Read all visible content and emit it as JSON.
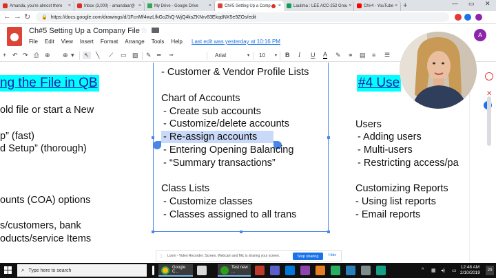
{
  "tabs": [
    {
      "label": "Amanda, you're almost there",
      "color": "#d93025",
      "active": false
    },
    {
      "label": "Inbox (3,000) - amandaar@",
      "color": "#d93025",
      "active": false
    },
    {
      "label": "My Drive - Google Drive",
      "color": "#34a853",
      "active": false
    },
    {
      "label": "Ch#5 Setting Up a Comp",
      "color": "#db4437",
      "active": true
    },
    {
      "label": "Laulima : LEE ACC-252 Grou",
      "color": "#0f9d58",
      "active": false
    },
    {
      "label": "Ch#4 - YouTube",
      "color": "#ff0000",
      "active": false
    }
  ],
  "tab_close": "×",
  "address": {
    "url": "https://docs.google.com/drawings/d/1FcnMf4wzLfkGoZhQ-WjQ4ksZKNrv83EkqdNX5e9ZOs/edit",
    "lock": "🔒"
  },
  "nav": {
    "back": "←",
    "forward": "→",
    "reload": "↻"
  },
  "doc": {
    "title": "Ch#5 Setting Up a Company File",
    "star": "☆",
    "menu": [
      "File",
      "Edit",
      "View",
      "Insert",
      "Format",
      "Arrange",
      "Tools",
      "Help"
    ],
    "last_edit": "Last edit was yesterday at 10:16 PM",
    "avatar": "A"
  },
  "toolbar": {
    "icons": [
      "+",
      "↶",
      "↷",
      "⎙",
      "⊕",
      "▾",
      "↖",
      "╲",
      "⟋",
      "▭",
      "▧",
      "▾",
      "✎",
      "━",
      "┅"
    ],
    "font": "Arial",
    "size": "10",
    "bold": "B",
    "italic": "I",
    "underline": "U",
    "color": "A"
  },
  "slide": {
    "left_heading": "ng the File in QB",
    "left_lines": [
      "old file or start a New",
      "p” (fast)",
      "d Setup” (thorough)",
      "ounts (COA) options",
      "s/customers, bank",
      "oducts/service Items"
    ],
    "center_top": "- Customer & Vendor Profile Lists",
    "center_heading_1": "Chart of Accounts",
    "center_list_1": [
      "- Create sub accounts",
      "- Customize/delete accounts",
      "- Re-assign accounts",
      "- Entering Opening Balancing",
      "- “Summary transactions”"
    ],
    "center_heading_2": "Class Lists",
    "center_list_2": [
      "- Customize classes",
      "- Classes assigned to all trans"
    ],
    "right_heading": "#4 Use",
    "right_heading_1": "Users",
    "right_list_1": [
      "- Adding users",
      "- Multi-users",
      "- Restricting access/pa"
    ],
    "right_heading_2": "Customizing Reports",
    "right_list_2": [
      "- Using list reports",
      "- Email reports"
    ]
  },
  "loom": {
    "message": "Loom - Video Recorder: Screen, Webcam and Mic is sharing your screen.",
    "stop": "Stop sharing",
    "hide": "Hide"
  },
  "taskbar": {
    "search": "Type here to search",
    "apps": [
      {
        "label": "Google C...",
        "color": "#fbbc04"
      },
      {
        "label": "Test new ...",
        "color": "#2ca01c"
      }
    ],
    "time": "12:48 AM",
    "date": "2/10/2019",
    "notifications": "20"
  },
  "colors": {
    "accent": "#4a86e8",
    "heading_bg": "#00ffff",
    "heading_text": "#1a1aa6",
    "highlight": "#c9daf8"
  }
}
